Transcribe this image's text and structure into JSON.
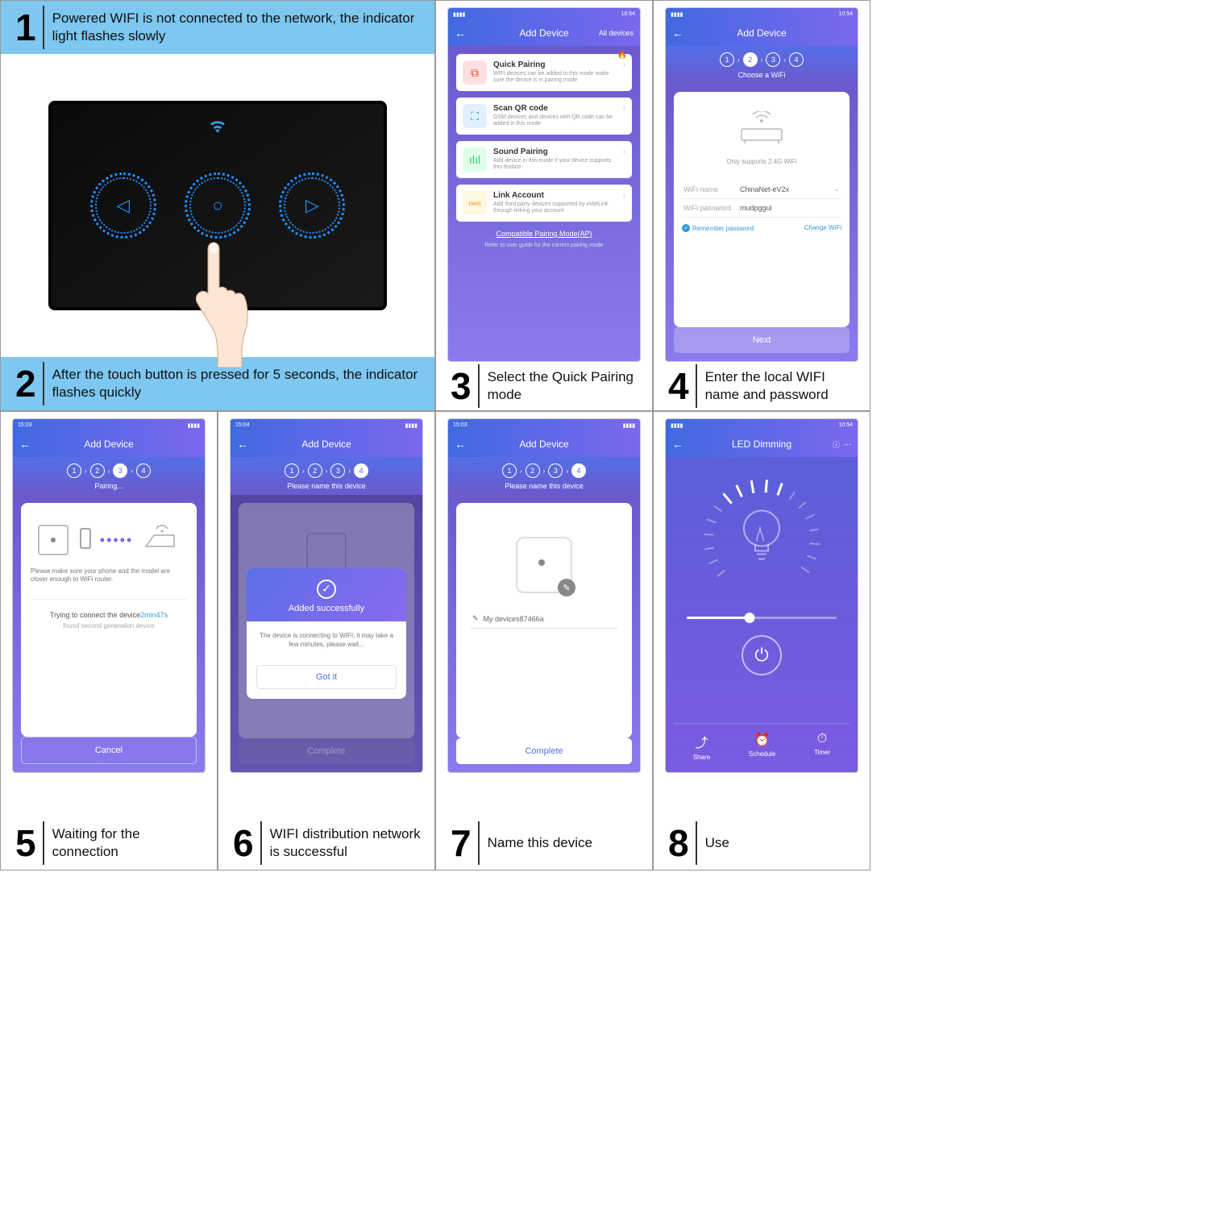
{
  "steps": {
    "s1": {
      "num": "1",
      "text": "Powered WIFI is not connected to the network, the indicator light flashes slowly"
    },
    "s2": {
      "num": "2",
      "text": "After the touch button is pressed for 5 seconds, the indicator flashes quickly"
    },
    "s3": {
      "num": "3",
      "text": "Select the Quick Pairing mode"
    },
    "s4": {
      "num": "4",
      "text": "Enter the local WIFI name and password"
    },
    "s5": {
      "num": "5",
      "text": "Waiting for the connection"
    },
    "s6": {
      "num": "6",
      "text": "WIFI distribution network is successful"
    },
    "s7": {
      "num": "7",
      "text": "Name this device"
    },
    "s8": {
      "num": "8",
      "text": "Use"
    }
  },
  "status": {
    "time1": "10:54",
    "time2": "15:03",
    "time3": "15:04",
    "signals": "▮▮▮▮"
  },
  "phone3": {
    "title": "Add Device",
    "all": "All devices",
    "hot": "🔥",
    "quick_t": "Quick Pairing",
    "quick_d": "WIFI devices can be added in this mode make sure the device is in pairing mode",
    "qr_t": "Scan QR code",
    "qr_d": "GSM devices and devices with QR code can be added in this mode",
    "sound_t": "Sound Pairing",
    "sound_d": "Add device in this mode if your device supports this feature",
    "link_t": "Link Account",
    "link_d": "Add third party devices supported by eWeLink through linking your account",
    "compat": "Compatible Pairing Mode(AP)",
    "hint": "Refer to user guide for the correct pairing mode"
  },
  "phone4": {
    "title": "Add Device",
    "choose": "Choose a WiFi",
    "support": "Only supports 2.4G WiFi",
    "name_l": "WiFi name",
    "name_v": "ChinaNet-eV2x",
    "pass_l": "WiFi password",
    "pass_v": "mudpggui",
    "remember": "Remember password",
    "change": "Change WiFi",
    "next": "Next"
  },
  "phone5": {
    "title": "Add Device",
    "pairing": "Pairing...",
    "msg": "Please make sure your phone and the model are closer enough to WiFi router.",
    "trying": "Trying to connect the device",
    "time": "2min47s",
    "found": "found second generation device",
    "cancel": "Cancel"
  },
  "phone6": {
    "title": "Add Device",
    "subtitle": "Please name this device",
    "added": "Added successfully",
    "body": "The device is connecting to WIFI, it may take a few minutes, please wait...",
    "gotit": "Got it",
    "complete": "Complete"
  },
  "phone7": {
    "title": "Add Device",
    "subtitle": "Please name this device",
    "name": "My devices87466a",
    "complete": "Complete"
  },
  "phone8": {
    "title": "LED Dimming",
    "share": "Share",
    "schedule": "Schedule",
    "timer": "Timer"
  }
}
